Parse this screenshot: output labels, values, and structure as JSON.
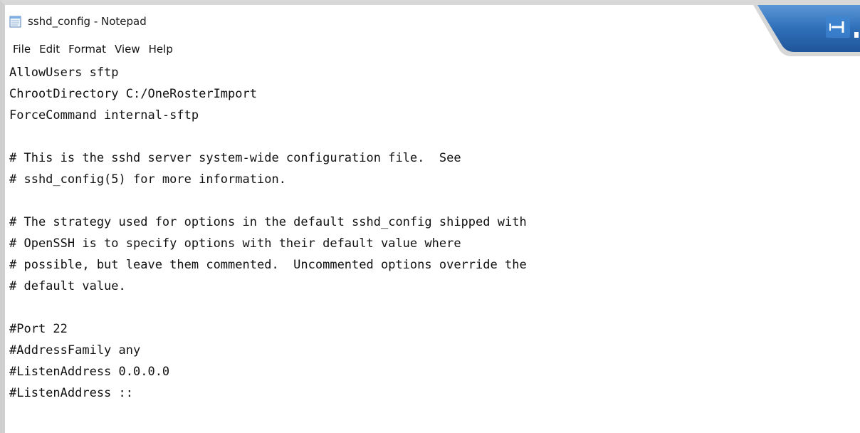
{
  "window": {
    "title": "sshd_config - Notepad",
    "app_icon": "notepad-icon"
  },
  "menubar": {
    "items": [
      "File",
      "Edit",
      "Format",
      "View",
      "Help"
    ]
  },
  "taskbar": {
    "icon": "pin-icon",
    "color": "#2b6cb8"
  },
  "editor": {
    "lines": [
      "AllowUsers sftp",
      "ChrootDirectory C:/OneRosterImport",
      "ForceCommand internal-sftp",
      "",
      "# This is the sshd server system-wide configuration file.  See",
      "# sshd_config(5) for more information.",
      "",
      "# The strategy used for options in the default sshd_config shipped with",
      "# OpenSSH is to specify options with their default value where",
      "# possible, but leave them commented.  Uncommented options override the",
      "# default value.",
      "",
      "#Port 22",
      "#AddressFamily any",
      "#ListenAddress 0.0.0.0",
      "#ListenAddress ::"
    ]
  }
}
